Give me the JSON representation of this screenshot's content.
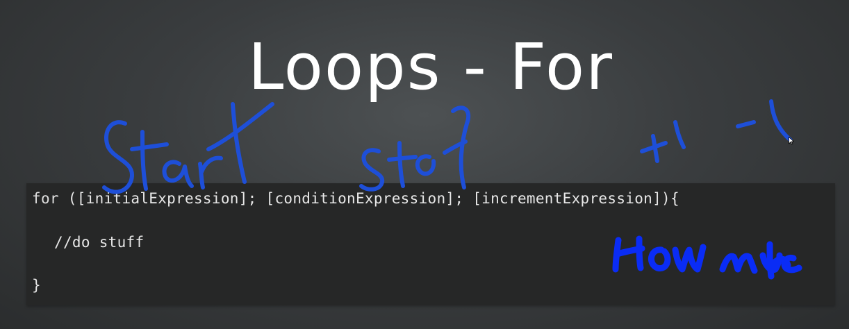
{
  "slide": {
    "title": "Loops - For"
  },
  "code": {
    "line1_keyword": "for",
    "line1_rest": " ([initialExpression]; [conditionExpression]; [incrementExpression]){",
    "line2": "//do stuff",
    "line3": "}"
  },
  "annotations": {
    "start": "Start",
    "stop": "stop",
    "plus_minus": "+1 -1",
    "how_much": "How much",
    "ink_color": "#1e4fd8",
    "ink_color_bright": "#0a2cf5"
  }
}
